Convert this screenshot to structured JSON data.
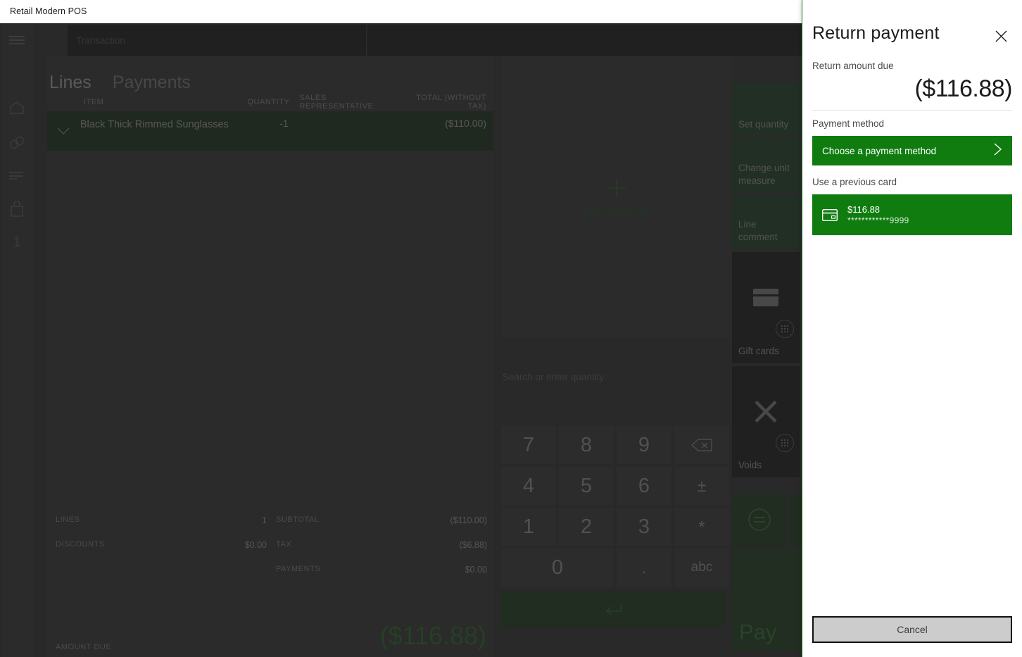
{
  "window": {
    "title": "Retail Modern POS",
    "controls": [
      {
        "name": "minimize",
        "glyph": "minimize-icon"
      },
      {
        "name": "maximize",
        "glyph": "maximize-icon"
      },
      {
        "name": "close",
        "glyph": "close-icon"
      }
    ]
  },
  "topbar": {
    "transaction_placeholder": "Transaction",
    "search_placeholder": "",
    "search_icon": "search-icon",
    "menu_icon": "hamburger-icon"
  },
  "rail": {
    "items": [
      {
        "icon": "home-icon",
        "label": ""
      },
      {
        "icon": "products-icon",
        "label": ""
      },
      {
        "icon": "lines-icon",
        "label": ""
      },
      {
        "icon": "shopping-bag-icon",
        "label": ""
      },
      {
        "icon": "count-indicator",
        "label": "1"
      }
    ]
  },
  "cart": {
    "tabs": [
      {
        "label": "Lines",
        "active": true
      },
      {
        "label": "Payments",
        "active": false
      }
    ],
    "columns": {
      "item": "ITEM",
      "quantity": "QUANTITY",
      "sales_rep": "SALES REPRESENTATIVE",
      "total": "TOTAL (WITHOUT TAX)"
    },
    "rows": [
      {
        "chevron": "chevron-down-icon",
        "item": "Black Thick Rimmed Sunglasses",
        "quantity": "-1",
        "sales_rep": "",
        "total": "($110.00)",
        "selected": true
      }
    ],
    "totals_left": [
      {
        "label": "LINES",
        "value": "1"
      },
      {
        "label": "DISCOUNTS",
        "value": "$0.00"
      }
    ],
    "totals_right": [
      {
        "label": "SUBTOTAL",
        "value": "($110.00)"
      },
      {
        "label": "TAX",
        "value": "($6.88)"
      },
      {
        "label": "PAYMENTS",
        "value": "$0.00"
      }
    ],
    "amount_due_label": "AMOUNT DUE",
    "amount_due_value": "($116.88)"
  },
  "customer": {
    "add_label": "Add customer",
    "add_icon": "plus-icon"
  },
  "keypad": {
    "hint": "Search or enter quantity",
    "keys": [
      {
        "label": "7",
        "name": "key-7",
        "type": "digit"
      },
      {
        "label": "8",
        "name": "key-8",
        "type": "digit"
      },
      {
        "label": "9",
        "name": "key-9",
        "type": "digit"
      },
      {
        "label": "backspace-icon",
        "name": "key-backspace",
        "type": "icon"
      },
      {
        "label": "4",
        "name": "key-4",
        "type": "digit"
      },
      {
        "label": "5",
        "name": "key-5",
        "type": "digit"
      },
      {
        "label": "6",
        "name": "key-6",
        "type": "digit"
      },
      {
        "label": "±",
        "name": "key-plus-minus",
        "type": "sym"
      },
      {
        "label": "1",
        "name": "key-1",
        "type": "digit"
      },
      {
        "label": "2",
        "name": "key-2",
        "type": "digit"
      },
      {
        "label": "3",
        "name": "key-3",
        "type": "digit"
      },
      {
        "label": "*",
        "name": "key-asterisk",
        "type": "sym"
      },
      {
        "label": "0",
        "name": "key-0",
        "type": "wide"
      },
      {
        "label": ".",
        "name": "key-decimal",
        "type": "sym"
      },
      {
        "label": "abc",
        "name": "key-abc",
        "type": "abc"
      }
    ],
    "enter_icon": "enter-icon"
  },
  "tiles": [
    {
      "label": "Set quantity",
      "name": "tile-set-quantity",
      "style": "green"
    },
    {
      "label": "Change unit measure",
      "name": "tile-change-unit-measure",
      "style": "green"
    },
    {
      "label": "Line comment",
      "name": "tile-line-comment",
      "style": "green"
    },
    {
      "label": "Gift cards",
      "name": "tile-gift-cards",
      "style": "dark",
      "icon": "credit-card-icon"
    },
    {
      "label": "Voids",
      "name": "tile-voids",
      "style": "dark",
      "icon": "x-mark-icon"
    },
    {
      "label": "Pay",
      "name": "tile-pay",
      "style": "pay"
    }
  ],
  "equals_tile": {
    "icon": "equals-circle-icon",
    "name": "tile-equals"
  },
  "flyout": {
    "title": "Return payment",
    "close_icon": "close-icon",
    "amount_label": "Return amount due",
    "amount_value": "($116.88)",
    "payment_method_label": "Payment method",
    "choose_button": "Choose a payment method",
    "choose_chevron": "chevron-right-icon",
    "previous_card_label": "Use a previous card",
    "card": {
      "icon": "credit-card-icon",
      "amount": "$116.88",
      "masked_number": "************9999"
    },
    "cancel_button": "Cancel"
  },
  "colors": {
    "brand_green": "#107c10",
    "panel_bg": "#ffffff",
    "app_bg": "#2b2b2b",
    "tile_green": "#12401b",
    "selected_row": "#0d2e0d"
  }
}
